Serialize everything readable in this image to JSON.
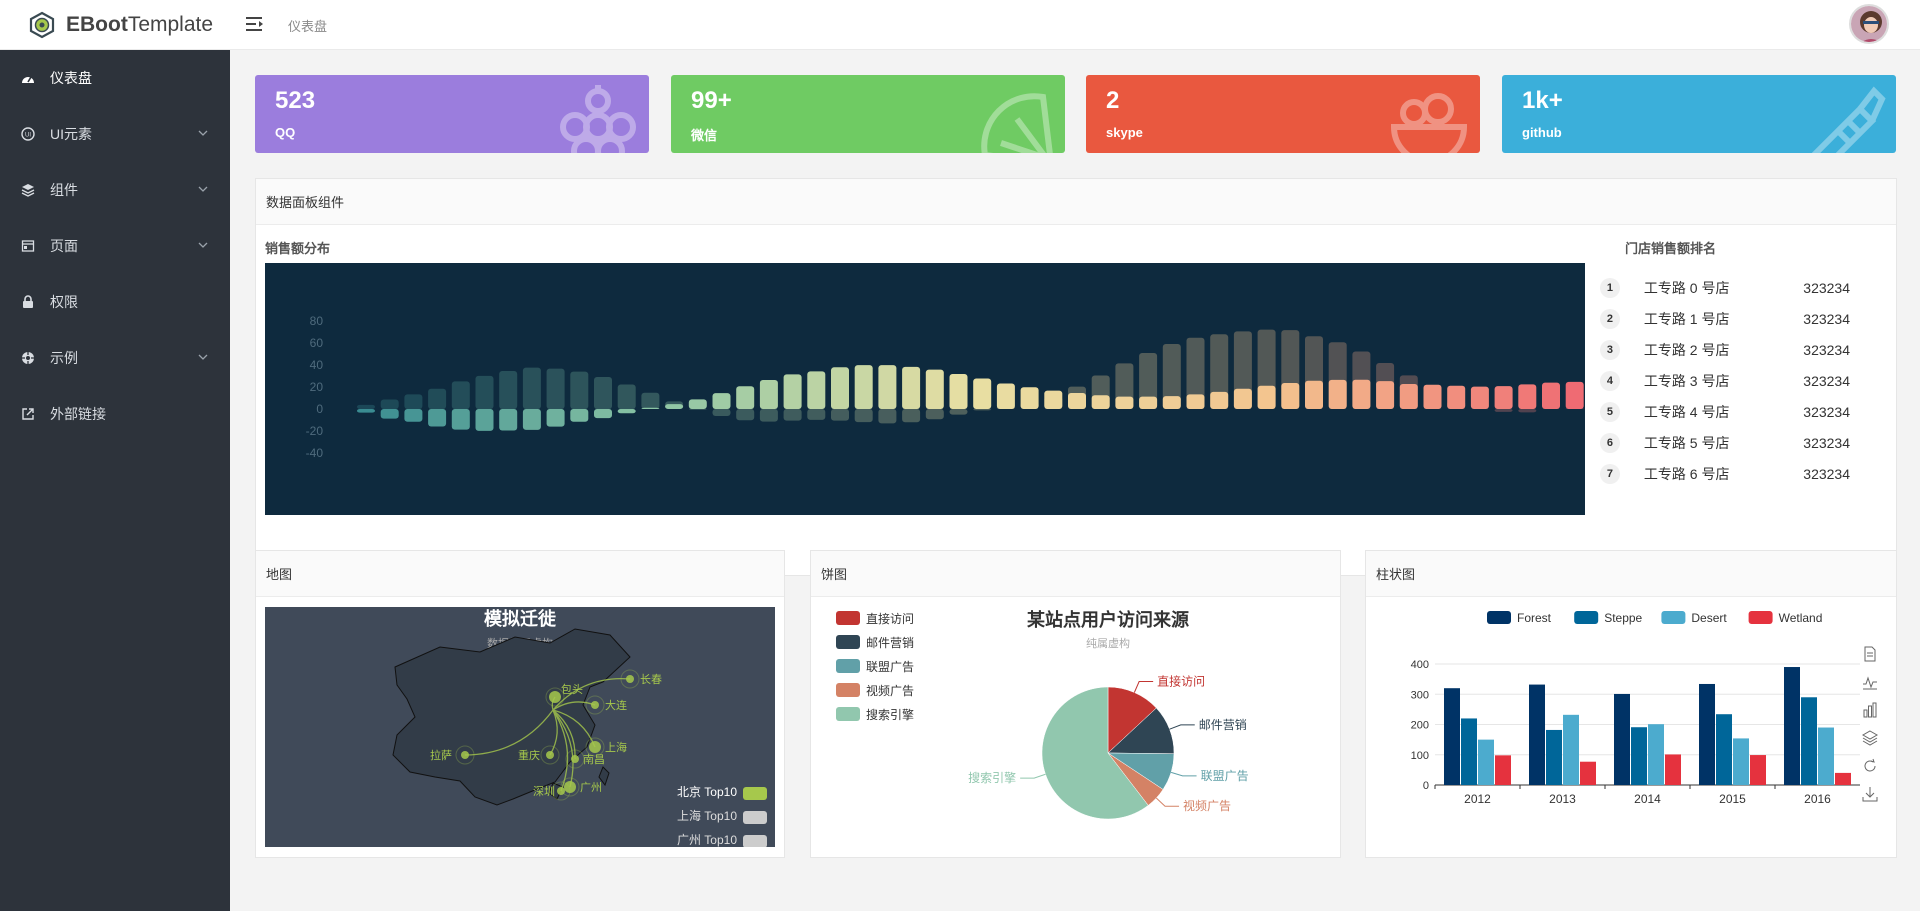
{
  "app": {
    "brand_bold": "EBoot",
    "brand_rest": "Template"
  },
  "header": {
    "breadcrumb": "仪表盘"
  },
  "sidebar": {
    "items": [
      {
        "label": "仪表盘",
        "icon": "dashboard-icon",
        "active": true,
        "has_children": false
      },
      {
        "label": "UI元素",
        "icon": "ui-icon",
        "active": false,
        "has_children": true
      },
      {
        "label": "组件",
        "icon": "layers-icon",
        "active": false,
        "has_children": true
      },
      {
        "label": "页面",
        "icon": "page-icon",
        "active": false,
        "has_children": true
      },
      {
        "label": "权限",
        "icon": "lock-icon",
        "active": false,
        "has_children": false
      },
      {
        "label": "示例",
        "icon": "crosshair-icon",
        "active": false,
        "has_children": true
      },
      {
        "label": "外部链接",
        "icon": "external-link-icon",
        "active": false,
        "has_children": false
      }
    ]
  },
  "stats": [
    {
      "value": "523",
      "label": "QQ",
      "color": "#9b7ddd",
      "icon": "grapes-icon"
    },
    {
      "value": "99+",
      "label": "微信",
      "color": "#6fcb63",
      "icon": "lemon-icon"
    },
    {
      "value": "2",
      "label": "skype",
      "color": "#e9583f",
      "icon": "fruit-bowl-icon"
    },
    {
      "value": "1k+",
      "label": "github",
      "color": "#3bafda",
      "icon": "candy-icon"
    }
  ],
  "data_panel": {
    "title": "数据面板组件",
    "sales_title": "销售额分布",
    "ranking_title": "门店销售额排名",
    "ranking": [
      {
        "rank": "1",
        "name": "工专路 0 号店",
        "value": "323234"
      },
      {
        "rank": "2",
        "name": "工专路 1 号店",
        "value": "323234"
      },
      {
        "rank": "3",
        "name": "工专路 2 号店",
        "value": "323234"
      },
      {
        "rank": "4",
        "name": "工专路 3 号店",
        "value": "323234"
      },
      {
        "rank": "5",
        "name": "工专路 4 号店",
        "value": "323234"
      },
      {
        "rank": "6",
        "name": "工专路 5 号店",
        "value": "323234"
      },
      {
        "rank": "7",
        "name": "工专路 6 号店",
        "value": "323234"
      }
    ]
  },
  "map_panel": {
    "title": "地图",
    "chart_title": "模拟迁徙",
    "chart_subtitle": "数据纯属虚构",
    "cities": [
      "长春",
      "大连",
      "包头",
      "上海",
      "拉萨",
      "重庆",
      "南昌",
      "广州",
      "深圳"
    ],
    "legend": [
      {
        "name": "北京 Top10",
        "color": "#a6c84c"
      },
      {
        "name": "上海 Top10",
        "color": "#cccccc"
      },
      {
        "name": "广州 Top10",
        "color": "#cccccc"
      }
    ]
  },
  "pie_panel": {
    "title": "饼图"
  },
  "bar_panel": {
    "title": "柱状图"
  },
  "chart_data": [
    {
      "type": "bar",
      "title": "",
      "ylim": [
        -40,
        80
      ],
      "yticks": [
        80,
        60,
        40,
        20,
        0,
        -20,
        -40
      ],
      "series": [
        {
          "values": [
            -3.3,
            -8.7,
            -11.6,
            -15.9,
            -18.8,
            -19.9,
            -19.6,
            -19.0,
            -16.0,
            -11.6,
            -8.3,
            -3.9,
            1.1,
            4.4,
            8.7,
            14.4,
            20.7,
            26.4,
            31.5,
            34.2,
            37.9,
            39.9,
            39.9,
            38.3,
            35.8,
            31.8,
            27.7,
            23.2,
            19.8,
            16.7,
            14.6,
            12.5,
            11.3,
            11.2,
            11.7,
            13.3,
            15.6,
            18.4,
            21.1,
            23.6,
            25.7,
            26.5,
            26.6,
            25.3,
            22.7,
            22.0,
            21.1,
            20.3,
            20.8,
            22.4,
            24.0,
            24.7
          ]
        },
        {
          "values": [
            3.8,
            8.6,
            13.3,
            18.4,
            25.1,
            30.1,
            34.6,
            37.6,
            36.7,
            34.0,
            29.1,
            22.3,
            14.8,
            6.9,
            -0.7,
            -6.4,
            -10.2,
            -11.5,
            -10.6,
            -9.9,
            -10.6,
            -11.9,
            -13.1,
            -12.1,
            -9.3,
            -5.1,
            -1.2,
            2.4,
            6.7,
            11.3,
            20.3,
            30.5,
            41.5,
            50.9,
            59.1,
            64.8,
            67.9,
            70.6,
            72.2,
            71.7,
            66.1,
            60.7,
            52.3,
            41.8,
            30.6,
            17.8,
            7.6,
            0.3,
            -2.6,
            -3.1,
            0.2,
            1.2
          ]
        }
      ]
    },
    {
      "type": "pie",
      "title": "某站点用户访问来源",
      "subtitle": "纯属虚构",
      "legend_position": "top-left",
      "categories": [
        "直接访问",
        "邮件营销",
        "联盟广告",
        "视频广告",
        "搜索引擎"
      ],
      "values": [
        335,
        310,
        234,
        135,
        1548
      ],
      "colors": [
        "#c23531",
        "#2f4554",
        "#61a0a8",
        "#d48265",
        "#91c7ae"
      ]
    },
    {
      "type": "bar",
      "categories": [
        "2012",
        "2013",
        "2014",
        "2015",
        "2016"
      ],
      "ylim": [
        0,
        400
      ],
      "yticks": [
        0,
        100,
        200,
        300,
        400
      ],
      "legend_position": "top",
      "series": [
        {
          "name": "Forest",
          "color": "#003366",
          "values": [
            320,
            332,
            301,
            334,
            390
          ]
        },
        {
          "name": "Steppe",
          "color": "#006699",
          "values": [
            220,
            182,
            191,
            234,
            290
          ]
        },
        {
          "name": "Desert",
          "color": "#4cabce",
          "values": [
            150,
            232,
            201,
            154,
            190
          ]
        },
        {
          "name": "Wetland",
          "color": "#e5323e",
          "values": [
            98,
            77,
            101,
            99,
            40
          ]
        }
      ]
    }
  ]
}
